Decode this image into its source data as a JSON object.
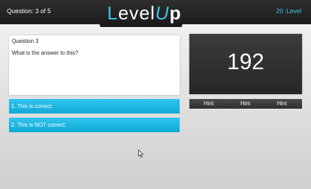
{
  "header": {
    "question_counter": "Question: 3 of 5",
    "logo": {
      "part1": "L",
      "part2": "evel",
      "part3": "U",
      "part4": "p"
    },
    "level": "20 :Level"
  },
  "question": {
    "title": "Question 3",
    "text": "What is the answer to this?"
  },
  "answers": [
    {
      "label": "1. This is correct."
    },
    {
      "label": "2. This is NOT correct."
    }
  ],
  "score": {
    "value": "192"
  },
  "hints": [
    {
      "label": "Hint"
    },
    {
      "label": "Hint"
    },
    {
      "label": "Hint"
    }
  ],
  "colors": {
    "accent": "#2fc4ee",
    "header_bg": "#222222",
    "score_bg": "#303030"
  },
  "icons": {
    "cursor": "mouse-pointer-icon"
  }
}
